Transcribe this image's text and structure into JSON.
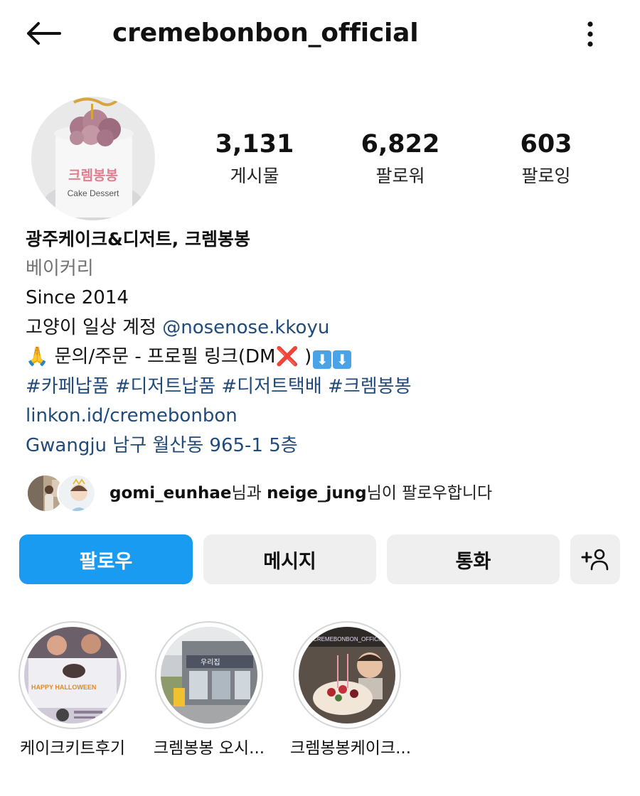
{
  "header": {
    "username": "cremebonbon_official",
    "back_icon": "arrow-left-icon",
    "more_icon": "more-vertical-icon"
  },
  "profile": {
    "avatar_text": "크렘봉봉",
    "avatar_subtext": "Cake Dessert",
    "stats": {
      "posts_count": "3,131",
      "posts_label": "게시물",
      "followers_count": "6,822",
      "followers_label": "팔로워",
      "following_count": "603",
      "following_label": "팔로잉"
    }
  },
  "bio": {
    "name": "광주케이크&디저트, 크렘봉봉",
    "category": "베이커리",
    "since": "Since 2014",
    "cat_account_prefix": "고양이 일상 계정 ",
    "cat_account_handle": "@nosenose.kkoyu",
    "inquiry_prefix": "🙏 문의/주문 - 프로필 링크(DM",
    "inquiry_x": "❌",
    "inquiry_suffix": " )",
    "inquiry_arrow_1": "⬇",
    "inquiry_arrow_2": "⬇",
    "hashtags": "#카페납품 #디저트납품 #디저트택배 #크렘봉봉",
    "website": "linkon.id/cremebonbon",
    "location": "Gwangju 남구 월산동 965-1  5층"
  },
  "mutual": {
    "user1": "gomi_eunhae",
    "connector": "님과 ",
    "user2": "neige_jung",
    "suffix": "님이 팔로우합니다"
  },
  "actions": {
    "follow_label": "팔로우",
    "message_label": "메시지",
    "call_label": "통화",
    "add_person_icon": "add-person-icon"
  },
  "highlights": [
    {
      "label": "케이크키트후기",
      "image_text": "HAPPY HALLOWEEN"
    },
    {
      "label": "크렘봉봉 오시...",
      "image_text": "우리집"
    },
    {
      "label": "크렘봉봉케이크...",
      "image_text": "@CREMEBONBON_OFFICIAL"
    }
  ],
  "colors": {
    "accent": "#1a9bf2",
    "link": "#1f4a7a",
    "secondary_text": "#737373",
    "button_gray": "#efefef"
  }
}
